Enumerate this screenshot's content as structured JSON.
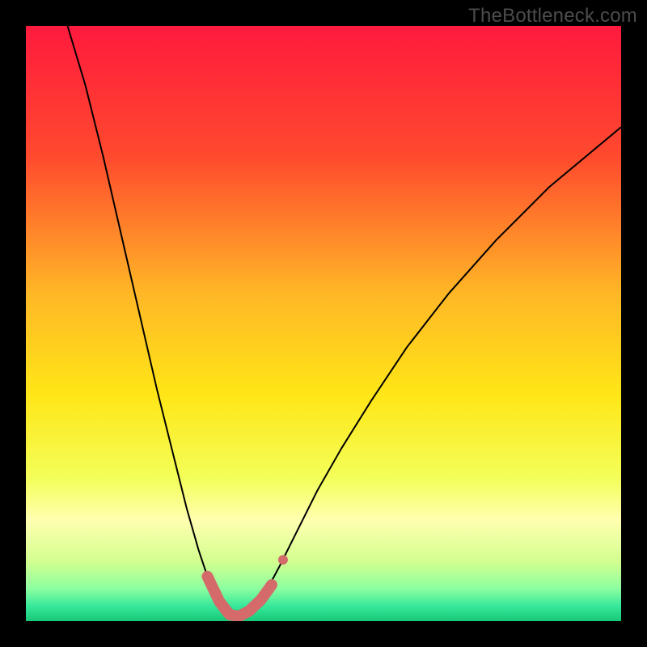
{
  "watermark": "TheBottleneck.com",
  "chart_data": {
    "type": "line",
    "title": "",
    "xlabel": "",
    "ylabel": "",
    "xlim": [
      0,
      100
    ],
    "ylim": [
      0,
      100
    ],
    "grid": false,
    "legend": false,
    "gradient_stops": [
      {
        "offset": 0,
        "color": "#ff1a3d"
      },
      {
        "offset": 0.22,
        "color": "#ff4a2e"
      },
      {
        "offset": 0.45,
        "color": "#ffb726"
      },
      {
        "offset": 0.62,
        "color": "#ffe617"
      },
      {
        "offset": 0.76,
        "color": "#f3ff59"
      },
      {
        "offset": 0.83,
        "color": "#ffffb0"
      },
      {
        "offset": 0.9,
        "color": "#d3ff8f"
      },
      {
        "offset": 0.945,
        "color": "#8dffa0"
      },
      {
        "offset": 0.975,
        "color": "#36e89a"
      },
      {
        "offset": 1.0,
        "color": "#18c877"
      }
    ],
    "series": [
      {
        "name": "bottleneck-curve",
        "color": "#000000",
        "width": 2,
        "x": [
          7,
          10,
          13,
          16,
          19,
          22,
          25,
          27,
          29,
          30.5,
          32,
          33,
          34,
          34.7,
          35.3,
          36,
          37,
          39,
          41,
          42.5,
          44,
          46,
          49,
          53,
          58,
          64,
          71,
          79,
          88,
          100
        ],
        "y": [
          100,
          90,
          78,
          65,
          52,
          39,
          27,
          19,
          12,
          7.5,
          4.2,
          2.4,
          1.3,
          0.7,
          0.7,
          0.8,
          1.5,
          3.2,
          6.2,
          9,
          12,
          16,
          22,
          29,
          37,
          46,
          55,
          64,
          73,
          83
        ]
      }
    ],
    "highlight_band": {
      "name": "optimal-range",
      "color": "#d46a6a",
      "width": 14,
      "linecap": "round",
      "x": [
        30.5,
        32.5,
        34.2,
        35.8,
        37.5,
        39.5,
        41.3
      ],
      "y": [
        7.5,
        3.3,
        1.1,
        0.8,
        1.7,
        3.6,
        6.1
      ]
    },
    "highlight_dot": {
      "name": "marker",
      "color": "#d46a6a",
      "radius": 6,
      "x": 43.2,
      "y": 10.3
    }
  }
}
